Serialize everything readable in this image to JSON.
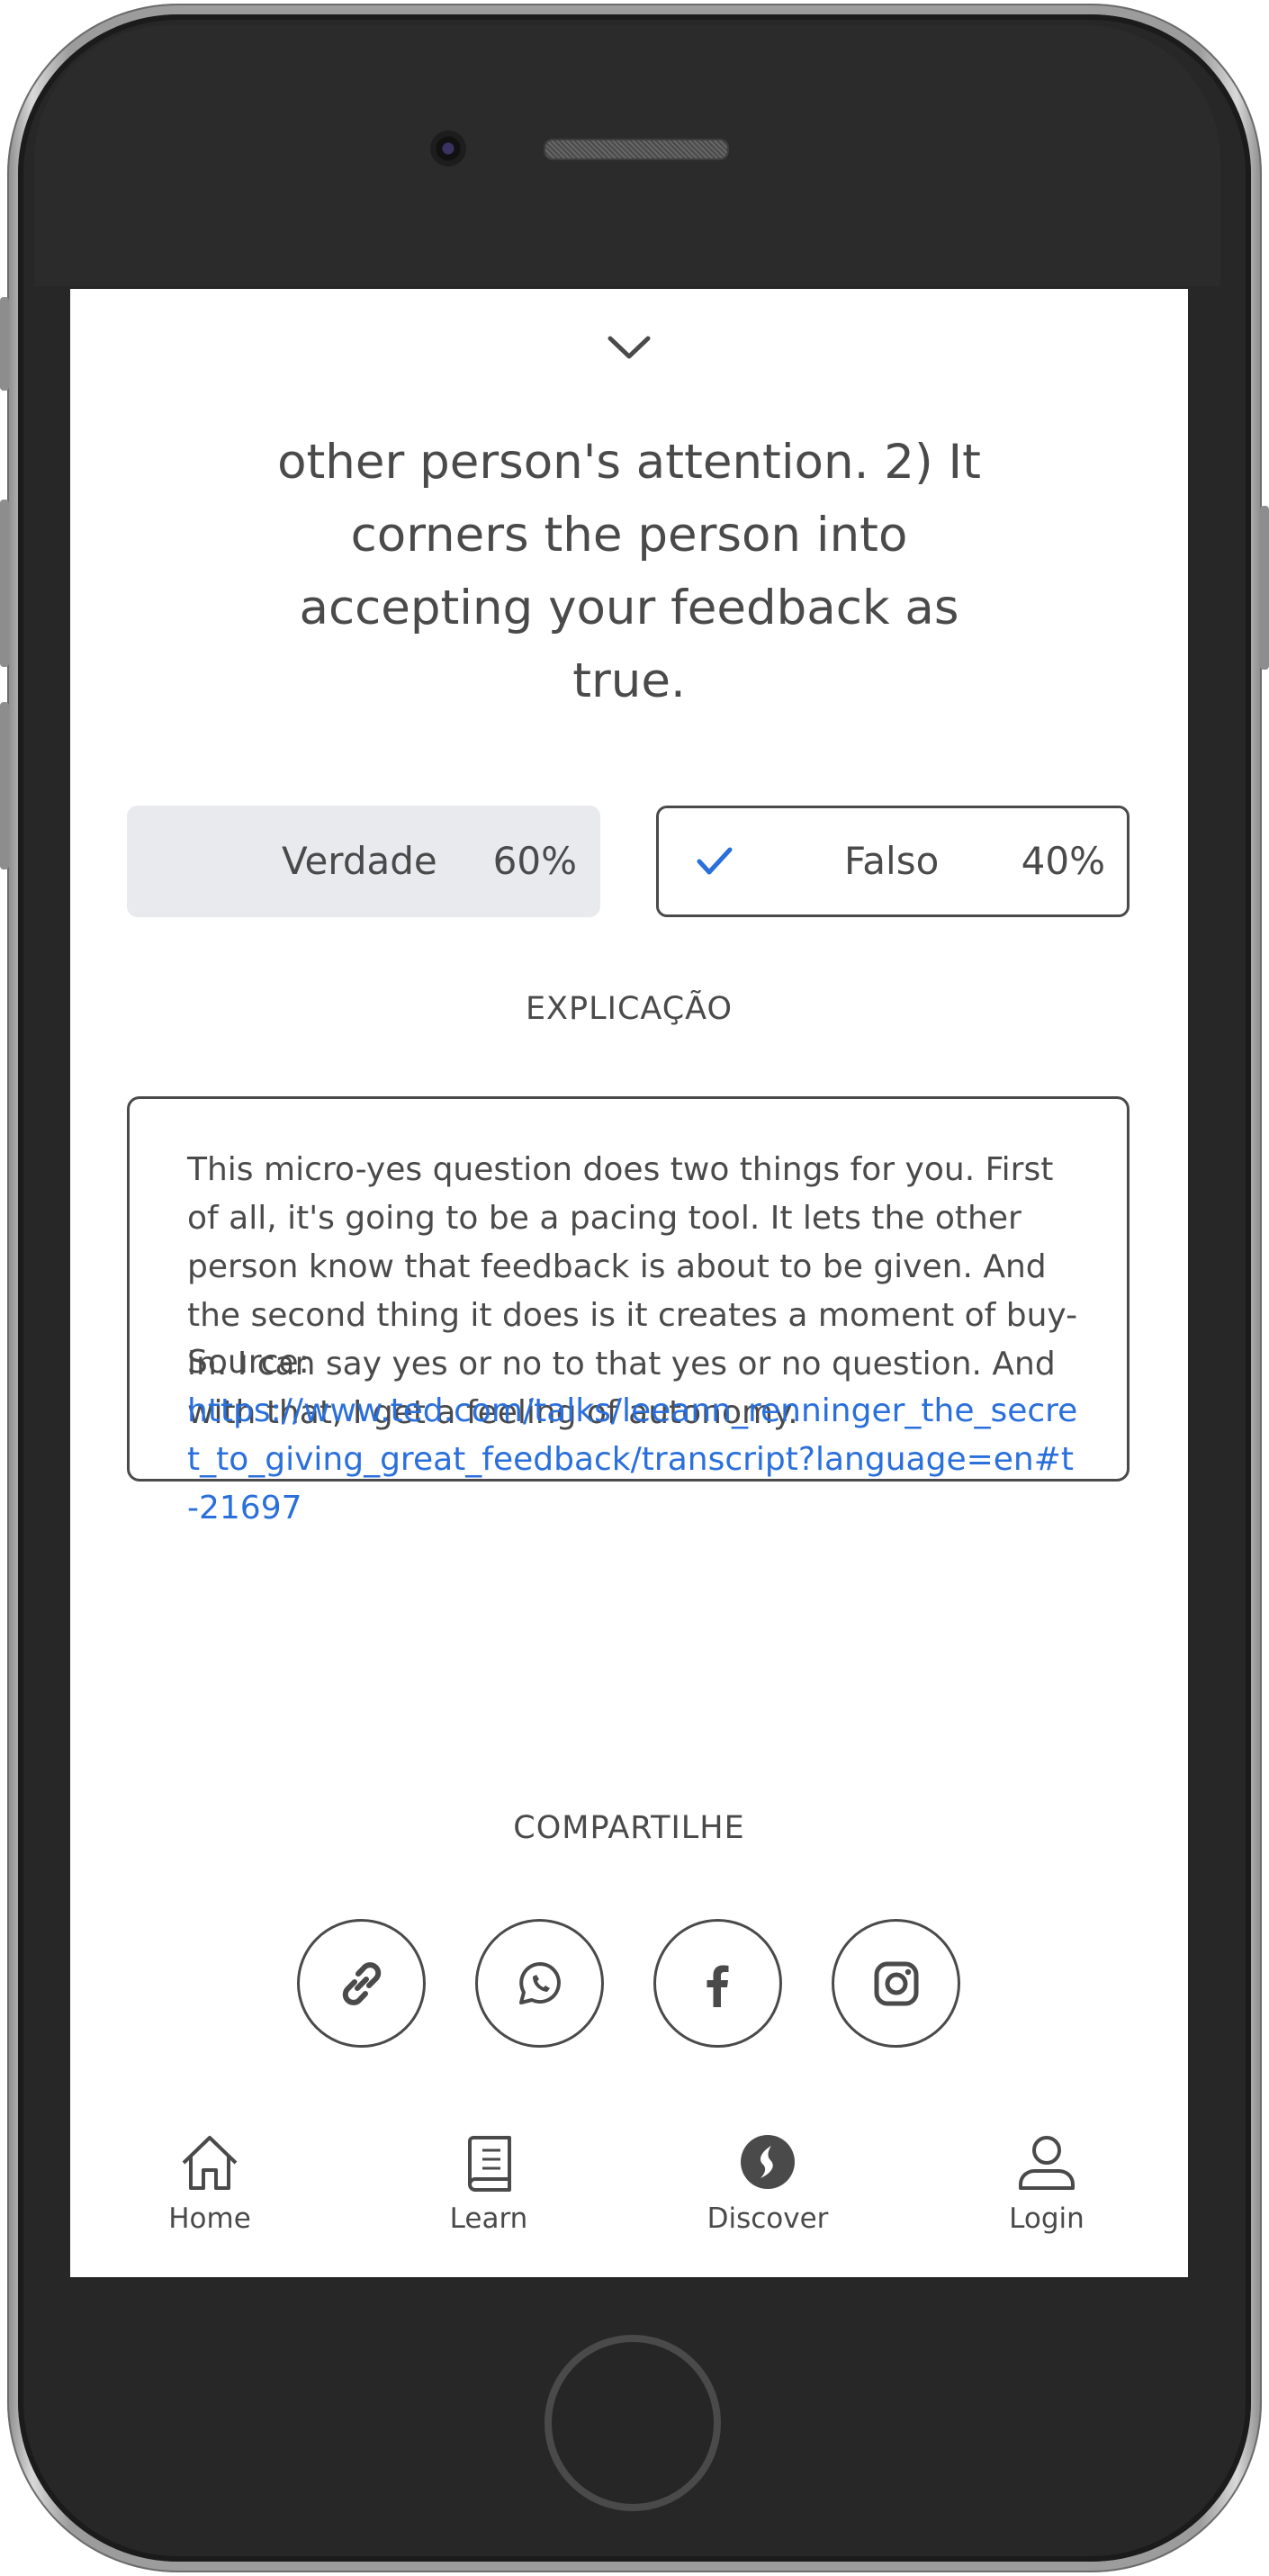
{
  "question": {
    "statement": "other person's attention. 2) It corners the person into accepting your feedback as true."
  },
  "options": [
    {
      "label": "Verdade",
      "percent": "60%",
      "correct": false
    },
    {
      "label": "Falso",
      "percent": "40%",
      "correct": true
    }
  ],
  "explanation": {
    "title": "EXPLICAÇÃO",
    "text": "This micro-yes question does two things for you. First of all, it's going to be a pacing tool. It lets the other person know that feedback is about to be given. And the second thing it does is it creates a moment of buy-in. I can say yes or no to that yes or no question. And with that, I get a feeling of autonomy.",
    "source_label": "Source:",
    "source_url": "https://www.ted.com/talks/leeann_renninger_the_secret_to_giving_great_feedback/transcript?language=en#t-21697"
  },
  "share": {
    "title": "COMPARTILHE",
    "icons": [
      "link-icon",
      "whatsapp-icon",
      "facebook-icon",
      "instagram-icon"
    ]
  },
  "nav": [
    {
      "label": "Home",
      "icon": "home-icon"
    },
    {
      "label": "Learn",
      "icon": "book-icon"
    },
    {
      "label": "Discover",
      "icon": "discover-icon"
    },
    {
      "label": "Login",
      "icon": "user-icon"
    }
  ],
  "colors": {
    "text": "#4a4a4a",
    "link": "#2a6fdb",
    "selected_bg": "#e8eaed",
    "screen_bg": "#ffffff",
    "device_body": "#272727"
  }
}
